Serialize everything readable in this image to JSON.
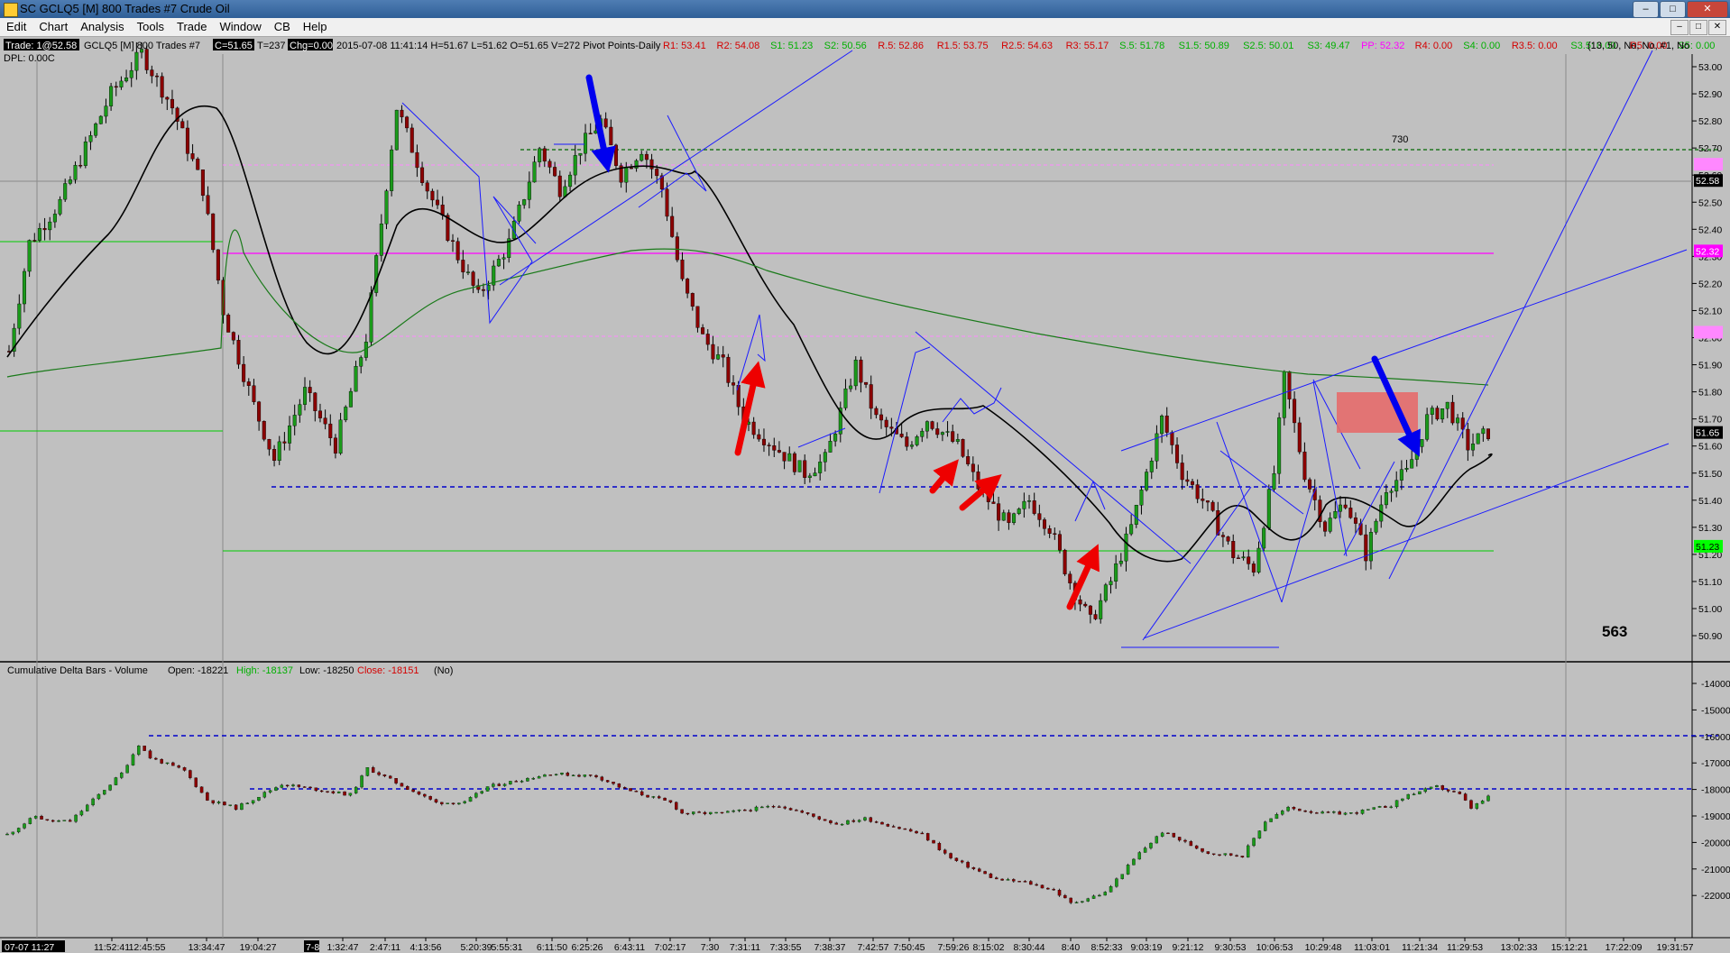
{
  "window": {
    "title": "SC GCLQ5 [M]  800 Trades  #7  Crude Oil",
    "buttons": [
      "–",
      "□",
      "✕"
    ]
  },
  "menu": [
    "Edit",
    "Chart",
    "Analysis",
    "Tools",
    "Trade",
    "Window",
    "CB",
    "Help"
  ],
  "info": {
    "trade_box": "Trade: 1@52.58",
    "symbol": "GCLQ5 [M]  800 Trades  #7",
    "close_box": "C=51.65",
    "t_label": "T=237",
    "chg_box": "Chg=0.00",
    "bar_info": "2015-07-08 11:41:14 H=51.67 L=51.62 O=51.65 V=272 Pivot Points-Daily",
    "dpl": "DPL: 0.00C",
    "right_params": "(13, 50, No, No, #1, No",
    "colors": {
      "red": "#d40000",
      "green": "#00b000",
      "pink": "#ff00ff"
    },
    "pivots": [
      {
        "t": "R1: 53.41",
        "c": "red"
      },
      {
        "t": "R2: 54.08",
        "c": "red"
      },
      {
        "t": "S1: 51.23",
        "c": "green"
      },
      {
        "t": "S2: 50.56",
        "c": "green"
      },
      {
        "t": "R.5: 52.86",
        "c": "red"
      },
      {
        "t": "R1.5: 53.75",
        "c": "red"
      },
      {
        "t": "R2.5: 54.63",
        "c": "red"
      },
      {
        "t": "R3: 55.17",
        "c": "red"
      },
      {
        "t": "S.5: 51.78",
        "c": "green"
      },
      {
        "t": "S1.5: 50.89",
        "c": "green"
      },
      {
        "t": "S2.5: 50.01",
        "c": "green"
      },
      {
        "t": "S3: 49.47",
        "c": "green"
      },
      {
        "t": "PP: 52.32",
        "c": "pink"
      },
      {
        "t": "R4: 0.00",
        "c": "red"
      },
      {
        "t": "S4: 0.00",
        "c": "green"
      },
      {
        "t": "R3.5: 0.00",
        "c": "red"
      },
      {
        "t": "S3.5: 0.00",
        "c": "green"
      },
      {
        "t": "R5: 0.00",
        "c": "red"
      },
      {
        "t": "S5: 0.00",
        "c": "green"
      }
    ]
  },
  "annotations": {
    "label_730": "730",
    "label_563": "563"
  },
  "price_axis": {
    "ticks": [
      "53.00",
      "52.90",
      "52.80",
      "52.70",
      "52.60",
      "52.50",
      "52.40",
      "52.30",
      "52.20",
      "52.10",
      "52.00",
      "51.90",
      "51.80",
      "51.70",
      "51.60",
      "51.50",
      "51.40",
      "51.30",
      "51.20",
      "51.10",
      "51.00",
      "50.90"
    ],
    "markers": [
      {
        "label": "52.58",
        "value": 52.58,
        "bg": "#000000",
        "fg": "#ffffff"
      },
      {
        "label": "52.32",
        "value": 52.32,
        "bg": "#ff00ff",
        "fg": "#ffffff"
      },
      {
        "label": "51.65",
        "value": 51.65,
        "bg": "#000000",
        "fg": "#ffffff"
      },
      {
        "label": "51.23",
        "value": 51.23,
        "bg": "#00ff00",
        "fg": "#000000"
      }
    ],
    "unlabeled_markers": [
      {
        "value": 52.64,
        "color": "#ff88ff"
      },
      {
        "value": 52.02,
        "color": "#ff88ff"
      }
    ]
  },
  "delta_panel": {
    "title": "Cumulative Delta Bars - Volume",
    "open": "Open: -18221",
    "high": "High: -18137",
    "low": "Low: -18250",
    "close": "Close: -18151",
    "flag": "(No)",
    "ticks": [
      "-14000",
      "-15000",
      "-16000",
      "-17000",
      "-18000",
      "-19000",
      "-20000",
      "-21000",
      "-22000"
    ]
  },
  "time_axis": {
    "start_box": "07-07  11:27",
    "day_box": "7-8",
    "labels": [
      "11:52:41",
      "12:45:55",
      "13:34:47",
      "19:04:27",
      "1:32:47",
      "2:47:11",
      "4:13:56",
      "5:20:39",
      "5:55:31",
      "6:11:50",
      "6:25:26",
      "6:43:11",
      "7:02:17",
      "7:30",
      "7:31:11",
      "7:33:55",
      "7:38:37",
      "7:42:57",
      "7:50:45",
      "7:59:26",
      "8:15:02",
      "8:30:44",
      "8:40",
      "8:52:33",
      "9:03:19",
      "9:21:12",
      "9:30:53",
      "10:06:53",
      "10:29:48",
      "11:03:01",
      "11:21:34",
      "11:29:53",
      "13:02:33",
      "15:12:21",
      "17:22:09",
      "19:31:57"
    ]
  },
  "chart_data": [
    {
      "type": "candlestick",
      "title": "SC GCLQ5 [M]  800 Trades  #7  Crude Oil",
      "ylim": [
        50.85,
        53.05
      ],
      "close_path_key_points": [
        {
          "bar": 0,
          "value": 51.95
        },
        {
          "bar": 4,
          "value": 52.35
        },
        {
          "bar": 10,
          "value": 52.5
        },
        {
          "bar": 20,
          "value": 52.9
        },
        {
          "bar": 26,
          "value": 53.05
        },
        {
          "bar": 32,
          "value": 52.85
        },
        {
          "bar": 38,
          "value": 52.55
        },
        {
          "bar": 42,
          "value": 52.1
        },
        {
          "bar": 48,
          "value": 51.75
        },
        {
          "bar": 52,
          "value": 51.55
        },
        {
          "bar": 58,
          "value": 51.8
        },
        {
          "bar": 64,
          "value": 51.6
        },
        {
          "bar": 70,
          "value": 52.0
        },
        {
          "bar": 76,
          "value": 52.85
        },
        {
          "bar": 82,
          "value": 52.55
        },
        {
          "bar": 88,
          "value": 52.3
        },
        {
          "bar": 92,
          "value": 52.15
        },
        {
          "bar": 98,
          "value": 52.35
        },
        {
          "bar": 104,
          "value": 52.7
        },
        {
          "bar": 108,
          "value": 52.55
        },
        {
          "bar": 112,
          "value": 52.7
        },
        {
          "bar": 116,
          "value": 52.8
        },
        {
          "bar": 120,
          "value": 52.6
        },
        {
          "bar": 124,
          "value": 52.7
        },
        {
          "bar": 128,
          "value": 52.55
        },
        {
          "bar": 132,
          "value": 52.2
        },
        {
          "bar": 136,
          "value": 52.0
        },
        {
          "bar": 140,
          "value": 51.9
        },
        {
          "bar": 144,
          "value": 51.7
        },
        {
          "bar": 150,
          "value": 51.6
        },
        {
          "bar": 156,
          "value": 51.5
        },
        {
          "bar": 160,
          "value": 51.55
        },
        {
          "bar": 166,
          "value": 51.9
        },
        {
          "bar": 170,
          "value": 51.7
        },
        {
          "bar": 176,
          "value": 51.6
        },
        {
          "bar": 180,
          "value": 51.7
        },
        {
          "bar": 186,
          "value": 51.6
        },
        {
          "bar": 190,
          "value": 51.45
        },
        {
          "bar": 196,
          "value": 51.3
        },
        {
          "bar": 200,
          "value": 51.4
        },
        {
          "bar": 204,
          "value": 51.3
        },
        {
          "bar": 208,
          "value": 51.1
        },
        {
          "bar": 212,
          "value": 50.95
        },
        {
          "bar": 216,
          "value": 51.1
        },
        {
          "bar": 220,
          "value": 51.3
        },
        {
          "bar": 226,
          "value": 51.7
        },
        {
          "bar": 230,
          "value": 51.5
        },
        {
          "bar": 234,
          "value": 51.4
        },
        {
          "bar": 240,
          "value": 51.2
        },
        {
          "bar": 244,
          "value": 51.15
        },
        {
          "bar": 248,
          "value": 51.5
        },
        {
          "bar": 250,
          "value": 51.85
        },
        {
          "bar": 254,
          "value": 51.5
        },
        {
          "bar": 258,
          "value": 51.3
        },
        {
          "bar": 262,
          "value": 51.4
        },
        {
          "bar": 266,
          "value": 51.2
        },
        {
          "bar": 270,
          "value": 51.45
        },
        {
          "bar": 274,
          "value": 51.5
        },
        {
          "bar": 278,
          "value": 51.7
        },
        {
          "bar": 282,
          "value": 51.75
        },
        {
          "bar": 286,
          "value": 51.6
        },
        {
          "bar": 290,
          "value": 51.65
        }
      ],
      "reference_lines": [
        {
          "value": 52.71,
          "style": "dashed",
          "color": "#006600"
        },
        {
          "value": 52.64,
          "style": "dashed",
          "color": "#ff88ff"
        },
        {
          "value": 52.32,
          "style": "solid",
          "color": "#ff00ff"
        },
        {
          "value": 52.02,
          "style": "dashed",
          "color": "#ff88ff"
        },
        {
          "value": 51.47,
          "style": "dashed",
          "color": "#0000cc"
        },
        {
          "value": 51.23,
          "style": "solid",
          "color": "#00cc00"
        }
      ]
    },
    {
      "type": "candlestick",
      "title": "Cumulative Delta Bars - Volume",
      "ylim": [
        -22500,
        -13500
      ],
      "open": -18221,
      "high": -18137,
      "low": -18250,
      "close": -18151,
      "reference_lines": [
        {
          "value": -15950,
          "style": "dashed",
          "color": "#0000cc"
        },
        {
          "value": -18850,
          "style": "dashed",
          "color": "#0000cc"
        }
      ]
    }
  ]
}
